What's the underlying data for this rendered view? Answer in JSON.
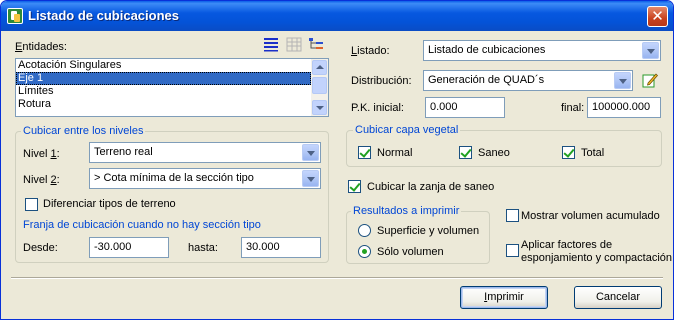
{
  "window": {
    "title": "Listado de cubicaciones",
    "close_glyph": "✕"
  },
  "entidades": {
    "label_u": "E",
    "label_rest": "ntidades:",
    "items": [
      "Acotación Singulares",
      "Eje 1",
      "Límites",
      "Rotura"
    ],
    "selected_index": 1,
    "toolbar_icons": [
      "list-lines-icon",
      "grid-icon",
      "tree-icon"
    ]
  },
  "cubicar_niveles": {
    "title": "Cubicar entre los niveles",
    "nivel1_label": "Nivel ",
    "nivel1_u": "1",
    "nivel1_colon": ":",
    "nivel1_value": "Terreno real",
    "nivel2_label": "Nivel ",
    "nivel2_u": "2",
    "nivel2_colon": ":",
    "nivel2_value": "> Cota mínima de la sección tipo",
    "diferenciar_label": "Diferenciar tipos de terreno",
    "diferenciar_checked": false
  },
  "franja": {
    "title": "Franja de cubicación cuando no hay sección tipo",
    "desde_label": "Desde:",
    "desde_value": "-30.000",
    "hasta_label": "hasta:",
    "hasta_value": "30.000"
  },
  "listado": {
    "label_u": "L",
    "label_rest": "istado:",
    "value": "Listado de cubicaciones"
  },
  "distribucion": {
    "label": "Distribución:",
    "value": "Generación de QUAD´s"
  },
  "pk": {
    "inicial_label": "P.K. inicial:",
    "inicial_value": "0.000",
    "final_label": "final:",
    "final_value": "100000.000"
  },
  "capa_vegetal": {
    "title": "Cubicar capa vegetal",
    "normal_label": "Normal",
    "normal_checked": true,
    "saneo_label": "Saneo",
    "saneo_checked": true,
    "total_label": "Total",
    "total_checked": true
  },
  "zanja": {
    "label": "Cubicar la zanja de saneo",
    "checked": true
  },
  "resultados": {
    "title": "Resultados a imprimir",
    "opt1_label": "Superficie y volumen",
    "opt1_selected": false,
    "opt2_label": "Sólo volumen",
    "opt2_selected": true
  },
  "mostrar_acumulado": {
    "label": "Mostrar volumen acumulado",
    "checked": false
  },
  "factores": {
    "label_line1": "Aplicar factores de",
    "label_line2": "esponjamiento y compactación",
    "checked": false
  },
  "buttons": {
    "imprimir_u": "I",
    "imprimir_rest": "mprimir",
    "cancelar": "Cancelar"
  },
  "colors": {
    "titlebar": "#0453d8",
    "group_title": "#0046d5",
    "selection": "#316ac5",
    "check": "#21a121"
  }
}
